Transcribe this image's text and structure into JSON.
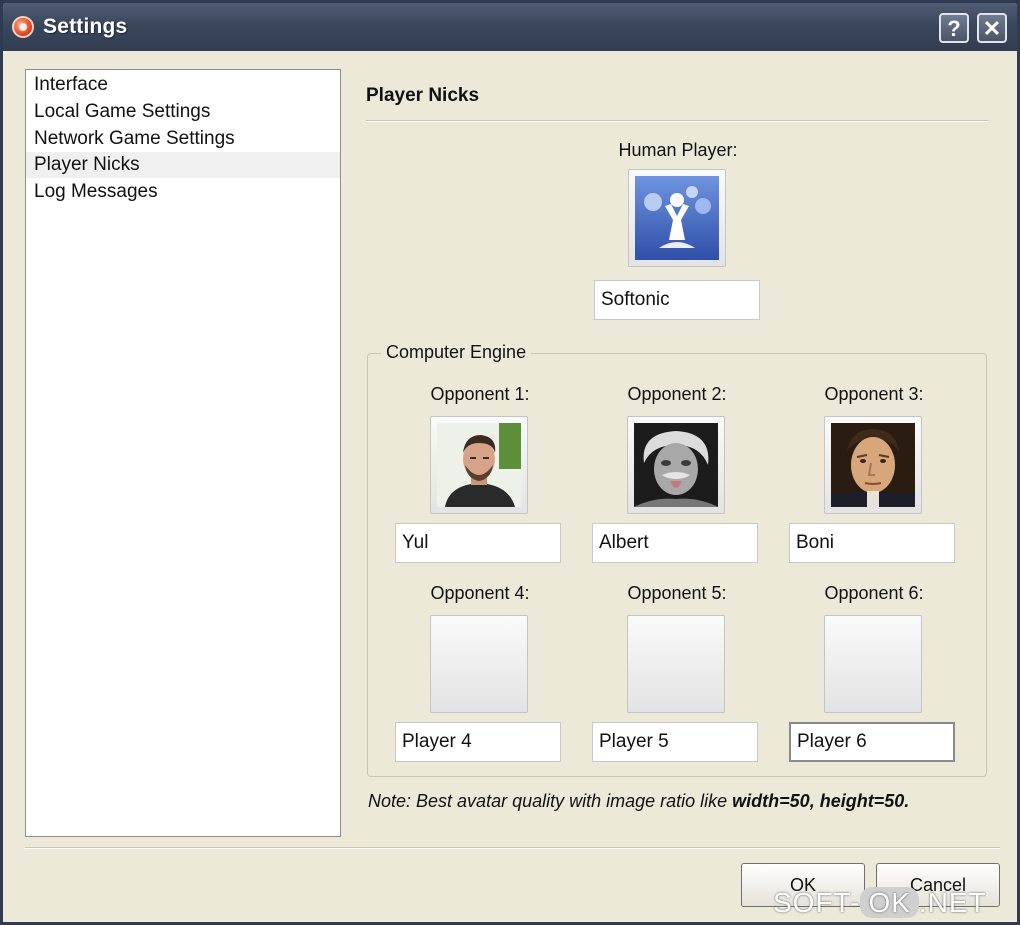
{
  "window": {
    "title": "Settings",
    "help_glyph": "?",
    "close_glyph": "✕"
  },
  "sidebar": {
    "items": [
      {
        "label": "Interface"
      },
      {
        "label": "Local Game Settings"
      },
      {
        "label": "Network Game Settings"
      },
      {
        "label": "Player Nicks",
        "selected": true
      },
      {
        "label": "Log Messages"
      }
    ]
  },
  "panel": {
    "title": "Player Nicks",
    "human": {
      "label": "Human Player:",
      "nick": "Softonic",
      "avatar_icon": "softonic-logo-icon"
    },
    "group_label": "Computer Engine",
    "opponents": [
      {
        "label": "Opponent 1:",
        "nick": "Yul",
        "avatar_icon": "man-photo-icon"
      },
      {
        "label": "Opponent 2:",
        "nick": "Albert",
        "avatar_icon": "einstein-photo-icon"
      },
      {
        "label": "Opponent 3:",
        "nick": "Boni",
        "avatar_icon": "napoleon-portrait-icon"
      },
      {
        "label": "Opponent 4:",
        "nick": "Player 4",
        "avatar_icon": ""
      },
      {
        "label": "Opponent 5:",
        "nick": "Player 5",
        "avatar_icon": ""
      },
      {
        "label": "Opponent 6:",
        "nick": "Player 6",
        "avatar_icon": ""
      }
    ],
    "note_prefix": "Note: Best avatar quality with image ratio like ",
    "note_bold": "width=50, height=50."
  },
  "buttons": {
    "ok": "OK",
    "cancel": "Cancel"
  },
  "watermark": {
    "left": "SOFT-",
    "pill": "OK",
    "right": ".NET"
  }
}
